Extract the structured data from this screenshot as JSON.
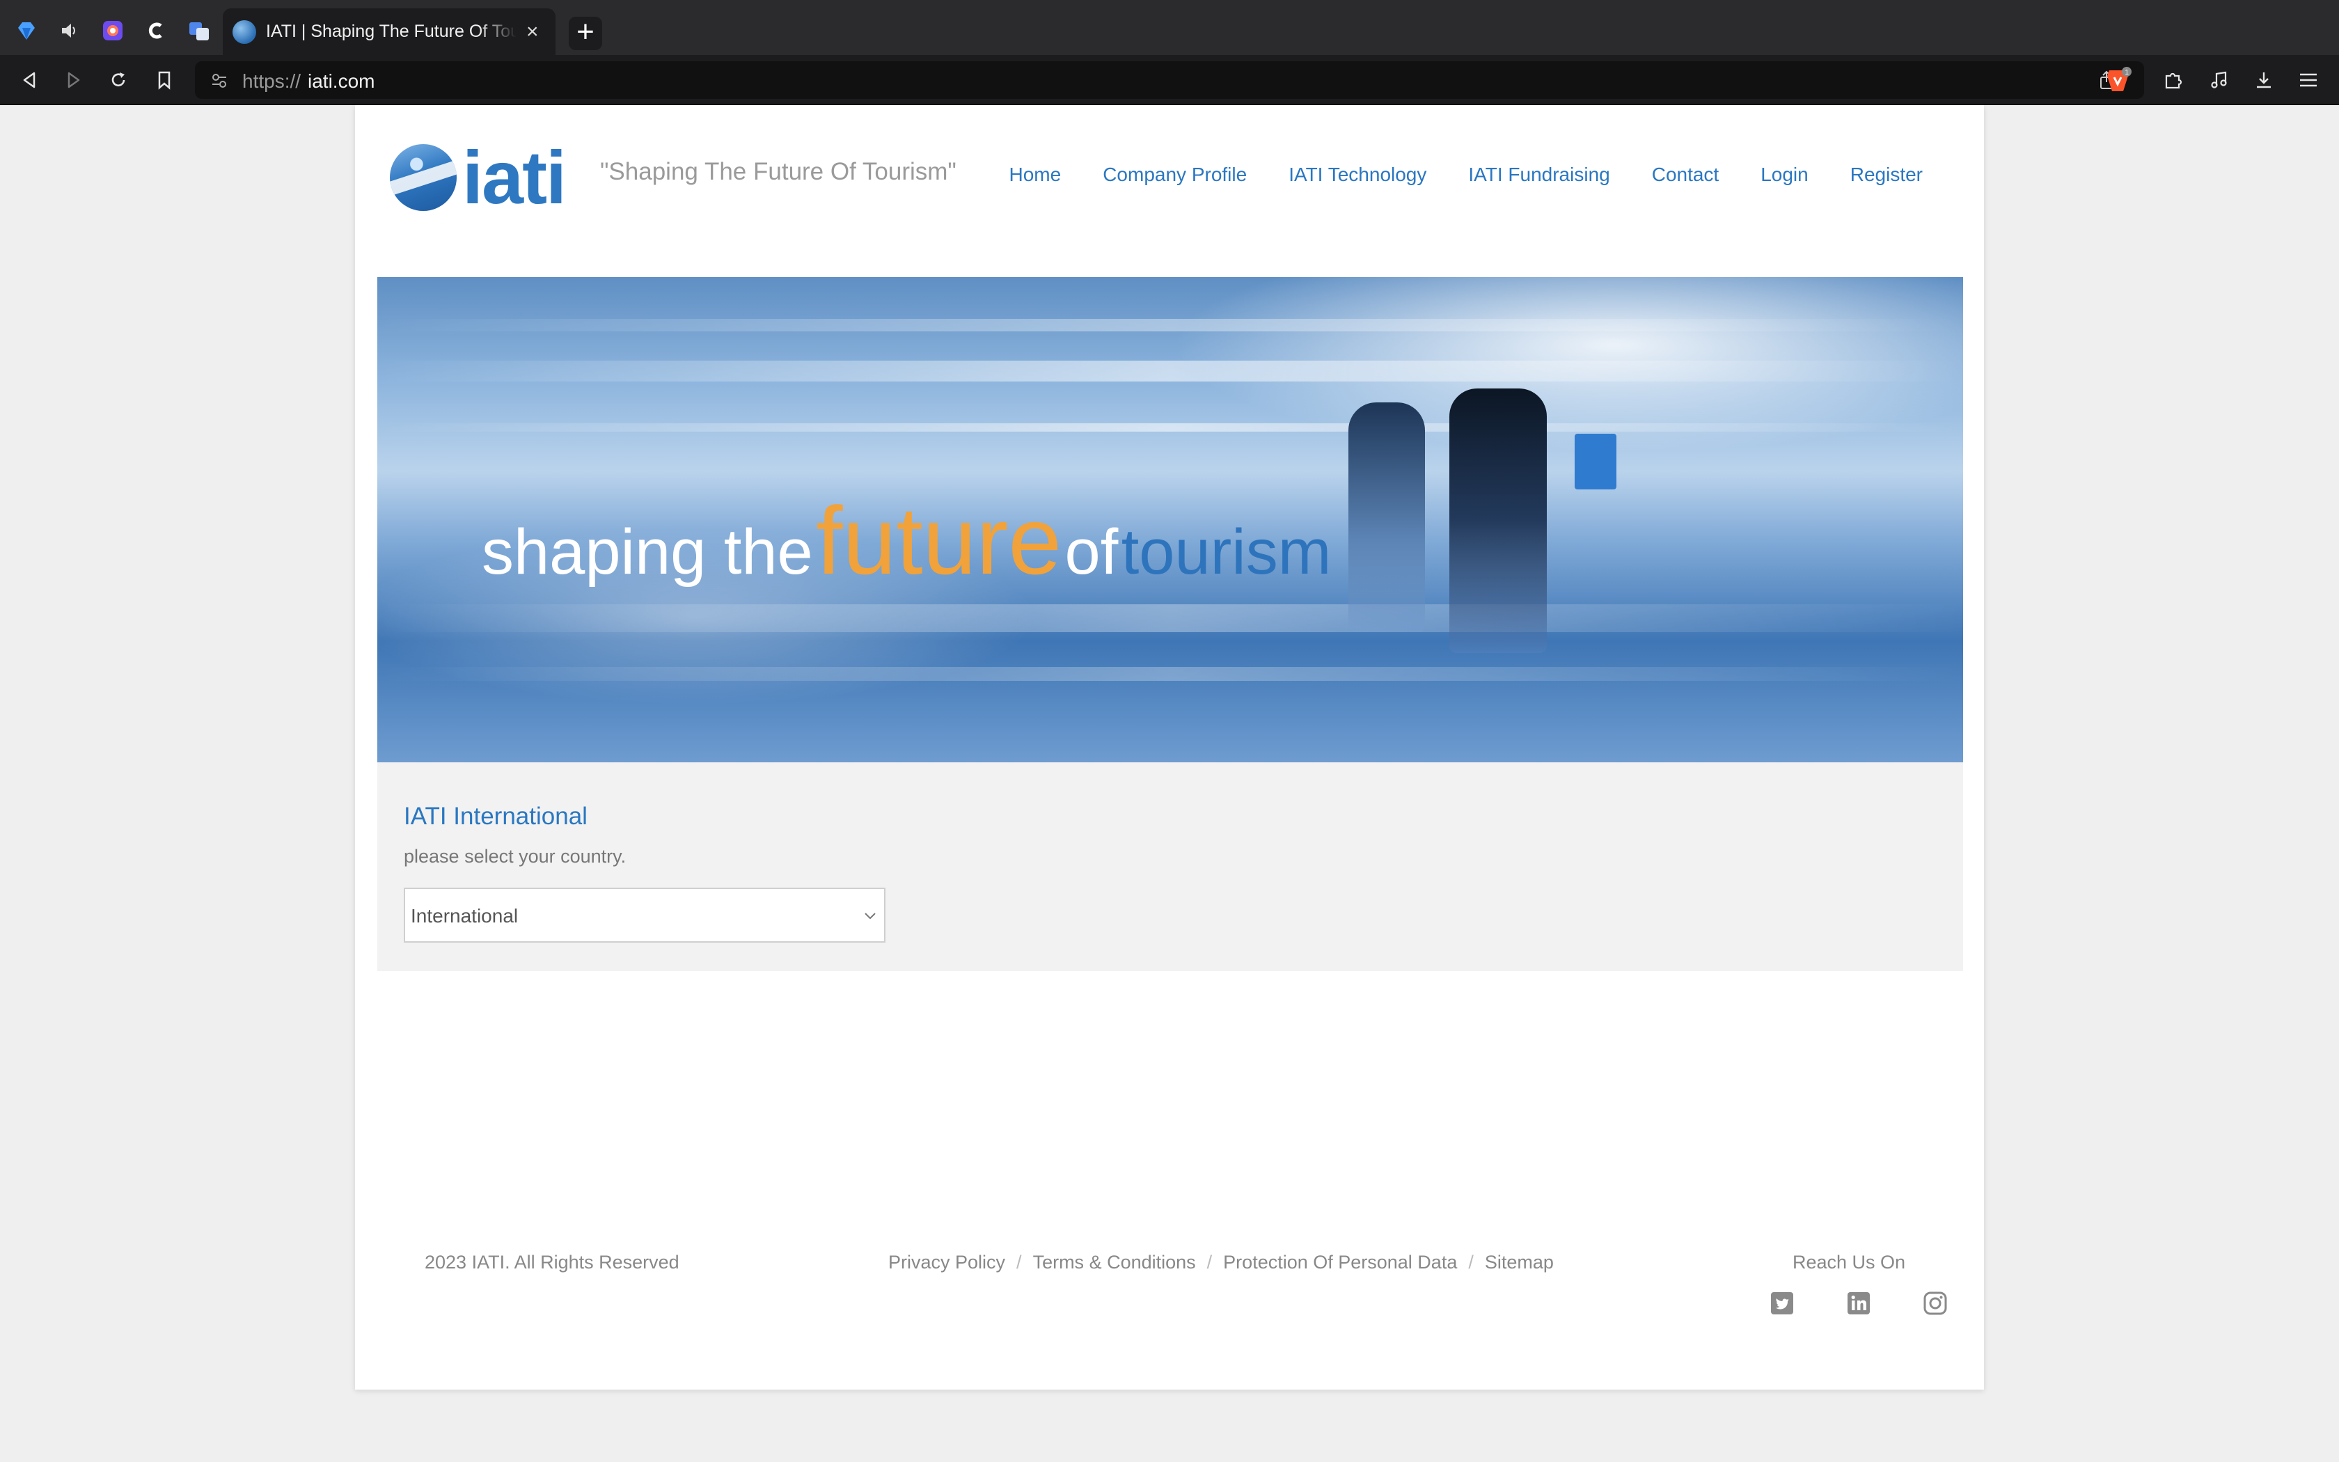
{
  "browser": {
    "active_tab_title": "IATI | Shaping The Future Of Tourism",
    "url_prefix": "https://",
    "url_host": "iati.com",
    "new_tab_label": "+",
    "close_tab_label": "×"
  },
  "header": {
    "logo_text": "iati",
    "tagline": "\"Shaping The Future Of Tourism\"",
    "nav": [
      "Home",
      "Company Profile",
      "IATI Technology",
      "IATI Fundraising",
      "Contact",
      "Login",
      "Register"
    ]
  },
  "hero": {
    "text_part1": "shaping the",
    "text_part2": "future",
    "text_part3": "of",
    "text_part4": "tourism",
    "colors": {
      "highlight": "#f1a23a",
      "blue": "#2e74bc"
    }
  },
  "country": {
    "title": "IATI International",
    "prompt": "please select your country.",
    "selected": "International"
  },
  "footer": {
    "copyright": "2023  IATI. All Rights Reserved",
    "links": [
      "Privacy Policy",
      "Terms & Conditions",
      "Protection Of Personal Data",
      "Sitemap"
    ],
    "separator": "/",
    "reach_label": "Reach Us On",
    "social_icons": [
      "twitter-icon",
      "linkedin-icon",
      "instagram-icon"
    ]
  },
  "colors": {
    "link_blue": "#2a77c1",
    "chrome_dark": "#1c1c1e"
  }
}
